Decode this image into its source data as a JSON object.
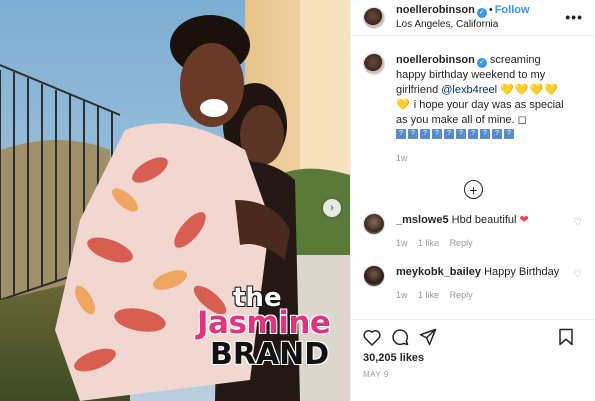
{
  "post": {
    "username": "noellerobinson",
    "follow_label": "Follow",
    "location": "Los Angeles, California",
    "more_label": "•••"
  },
  "watermark": {
    "line1": "the",
    "line2": "Jasmine",
    "line3": "BRAND"
  },
  "caption": {
    "username": "noellerobinson",
    "text_before": "screaming happy birthday weekend to my girlfriend",
    "mention": "@lexb4reel",
    "hearts": "💛💛💛💛💛",
    "text_after": "i hope your day was as special as you make all of mine. ◻",
    "boxes": [
      "?",
      "?",
      "?",
      "?",
      "?",
      "?",
      "?",
      "?",
      "?",
      "?"
    ],
    "time": "1w"
  },
  "comments": [
    {
      "username": "_mslowe5",
      "text": "Hbd beautiful",
      "emoji": "❤",
      "time": "1w",
      "likes": "1 like",
      "reply": "Reply"
    },
    {
      "username": "meykobk_bailey",
      "text": "Happy Birthday",
      "emoji": "",
      "time": "1w",
      "likes": "1 like",
      "reply": "Reply"
    }
  ],
  "footer": {
    "likes": "30,205 likes",
    "date": "MAY 9"
  },
  "colors": {
    "accent": "#3897f0",
    "heart": "#ed4956",
    "muted": "#999999"
  },
  "icons": [
    "verified-icon",
    "more-icon",
    "plus-icon",
    "heart-icon",
    "comment-icon",
    "share-icon",
    "bookmark-icon",
    "chevron-right-icon"
  ]
}
